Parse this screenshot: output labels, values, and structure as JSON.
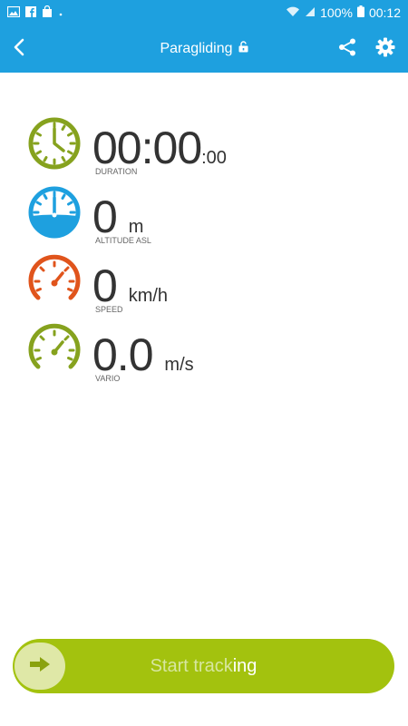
{
  "status_bar": {
    "battery": "100%",
    "time": "00:12",
    "left_icons": [
      "gallery-icon",
      "facebook-icon",
      "shopping-bag-icon",
      "dot-icon"
    ],
    "right_icons": [
      "wifi-icon",
      "signal-icon",
      "battery-icon"
    ]
  },
  "app_bar": {
    "title": "Paragliding",
    "actions": [
      "share-icon",
      "settings-gear-icon"
    ]
  },
  "metrics": [
    {
      "id": "duration",
      "value": "00:00",
      "unit": ":00",
      "label": "DURATION",
      "color": "#86a21e"
    },
    {
      "id": "altitude",
      "value": "0",
      "unit": "m",
      "label": "ALTITUDE ASL",
      "color": "#1ea0df"
    },
    {
      "id": "speed",
      "value": "0",
      "unit": "km/h",
      "label": "SPEED",
      "color": "#e0541c"
    },
    {
      "id": "vario",
      "value": "0.0",
      "unit": "m/s",
      "label": "VARIO",
      "color": "#86a21e"
    }
  ],
  "start_button": {
    "label_dim": "Start track",
    "label_bright": "ing",
    "color": "#a3c20e"
  },
  "colors": {
    "primary": "#1ea0df",
    "accent": "#a3c20e"
  }
}
